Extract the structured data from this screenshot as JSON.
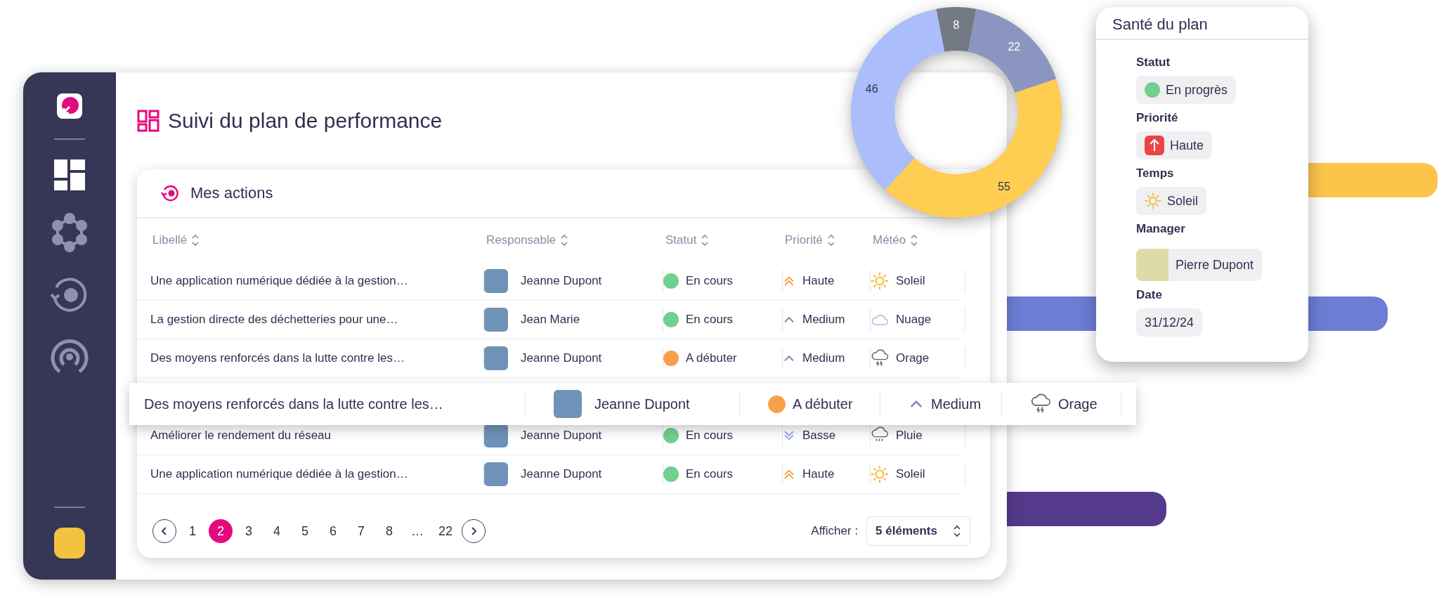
{
  "sidebar": {
    "items": [
      {
        "kind": "dashboard",
        "selected": true
      },
      {
        "kind": "network",
        "selected": false
      },
      {
        "kind": "cycle",
        "selected": false
      },
      {
        "kind": "broadcast",
        "selected": false
      }
    ]
  },
  "page": {
    "title": "Suivi du plan de performance"
  },
  "actions": {
    "title": "Mes actions",
    "columns": [
      "Libellé",
      "Responsable",
      "Statut",
      "Priorité",
      "Météo"
    ],
    "rows": [
      {
        "label": "Une application numérique dédiée à la gestion…",
        "owner": "Jeanne Dupont",
        "status": {
          "label": "En cours",
          "color": "#6fd08f"
        },
        "priority": {
          "label": "Haute",
          "kind": "high"
        },
        "weather": {
          "label": "Soleil",
          "kind": "sun"
        }
      },
      {
        "label": "La gestion directe des déchetteries pour une…",
        "owner": "Jean Marie",
        "status": {
          "label": "En cours",
          "color": "#6fd08f"
        },
        "priority": {
          "label": "Medium",
          "kind": "medium"
        },
        "weather": {
          "label": "Nuage",
          "kind": "cloud"
        }
      },
      {
        "label": "Des moyens renforcés dans la lutte contre les…",
        "owner": "Jeanne Dupont",
        "status": {
          "label": "A débuter",
          "color": "#f7a04b"
        },
        "priority": {
          "label": "Medium",
          "kind": "medium"
        },
        "weather": {
          "label": "Orage",
          "kind": "storm"
        }
      },
      {
        "label": "Améliorer le rendement du réseau",
        "owner": "Jeanne Dupont",
        "status": {
          "label": "En cours",
          "color": "#6fd08f"
        },
        "priority": {
          "label": "Basse",
          "kind": "low"
        },
        "weather": {
          "label": "Pluie",
          "kind": "rain"
        }
      },
      {
        "label": "Une application numérique dédiée à la gestion…",
        "owner": "Jeanne Dupont",
        "status": {
          "label": "En cours",
          "color": "#6fd08f"
        },
        "priority": {
          "label": "Haute",
          "kind": "high"
        },
        "weather": {
          "label": "Soleil",
          "kind": "sun"
        }
      }
    ],
    "highlighted_row": {
      "label": "Des moyens renforcés dans la lutte contre les…",
      "owner": "Jeanne Dupont",
      "status": {
        "label": "A débuter",
        "color": "#f7a04b"
      },
      "priority": {
        "label": "Medium",
        "kind": "medium"
      },
      "weather": {
        "label": "Orage",
        "kind": "storm"
      }
    },
    "pagination": {
      "pages": [
        {
          "label": "1",
          "selected": false
        },
        {
          "label": "2",
          "selected": true
        },
        {
          "label": "3",
          "selected": false
        },
        {
          "label": "4",
          "selected": false
        },
        {
          "label": "5",
          "selected": false
        },
        {
          "label": "6",
          "selected": false
        },
        {
          "label": "7",
          "selected": false
        },
        {
          "label": "8",
          "selected": false
        },
        {
          "label": "…",
          "selected": false
        },
        {
          "label": "22",
          "selected": false
        }
      ],
      "show_label": "Afficher :",
      "show_value": "5 éléments"
    }
  },
  "donut": {
    "chart_data": {
      "type": "donut",
      "values": [
        8,
        22,
        55,
        46
      ],
      "data_labels": true
    }
  },
  "health": {
    "title": "Santé du plan",
    "fields": [
      {
        "kind": "status",
        "label": "Statut",
        "value": "En progrès",
        "color": "#6fd08f"
      },
      {
        "kind": "priority",
        "label": "Priorité",
        "value": "Haute"
      },
      {
        "kind": "weather",
        "label": "Temps",
        "value": "Soleil"
      },
      {
        "kind": "person",
        "label": "Manager",
        "value": "Pierre Dupont"
      },
      {
        "kind": "text",
        "label": "Date",
        "value": "31/12/24"
      }
    ]
  }
}
